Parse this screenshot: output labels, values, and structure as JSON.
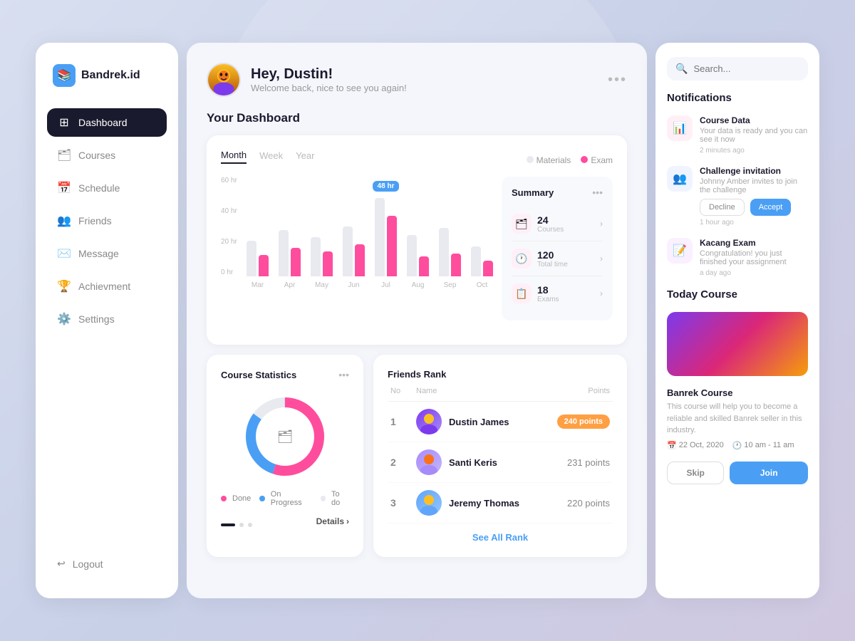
{
  "app": {
    "name": "Bandrek.id"
  },
  "sidebar": {
    "logo_label": "Bandrek.id",
    "nav_items": [
      {
        "id": "dashboard",
        "label": "Dashboard",
        "active": true
      },
      {
        "id": "courses",
        "label": "Courses",
        "active": false
      },
      {
        "id": "schedule",
        "label": "Schedule",
        "active": false
      },
      {
        "id": "friends",
        "label": "Friends",
        "active": false
      },
      {
        "id": "message",
        "label": "Message",
        "active": false
      },
      {
        "id": "achievment",
        "label": "Achievment",
        "active": false
      },
      {
        "id": "settings",
        "label": "Settings",
        "active": false
      }
    ],
    "logout_label": "Logout"
  },
  "header": {
    "greeting": "Hey, Dustin!",
    "subtext": "Welcome back, nice to see you again!"
  },
  "dashboard": {
    "title": "Your Dashboard"
  },
  "chart": {
    "tabs": [
      "Month",
      "Week",
      "Year"
    ],
    "active_tab": "Month",
    "legend": {
      "materials_label": "Materials",
      "exam_label": "Exam"
    },
    "y_labels": [
      "60 hr",
      "40 hr",
      "20 hr",
      "0 hr"
    ],
    "bars": [
      {
        "month": "Mar",
        "materials": 50,
        "exam": 30
      },
      {
        "month": "Apr",
        "materials": 60,
        "exam": 40
      },
      {
        "month": "May",
        "materials": 55,
        "exam": 35
      },
      {
        "month": "Jun",
        "materials": 65,
        "exam": 45
      },
      {
        "month": "Jul",
        "materials": 100,
        "exam": 80,
        "tooltip": "48 hr",
        "highlighted": true
      },
      {
        "month": "Aug",
        "materials": 55,
        "exam": 25
      },
      {
        "month": "Sep",
        "materials": 65,
        "exam": 30
      },
      {
        "month": "Oct",
        "materials": 40,
        "exam": 20
      }
    ],
    "summary": {
      "title": "Summary",
      "items": [
        {
          "label": "Courses",
          "value": "24"
        },
        {
          "label": "Total time",
          "value": "120"
        },
        {
          "label": "Exams",
          "value": "18"
        }
      ]
    }
  },
  "course_stats": {
    "title": "Course Statistics",
    "legend": [
      {
        "label": "Done",
        "color": "#ff4d9e"
      },
      {
        "label": "On Progress",
        "color": "#4a9ff5"
      },
      {
        "label": "To do",
        "color": "#e8eaf0"
      }
    ],
    "details_label": "Details",
    "donut": {
      "done_pct": 55,
      "progress_pct": 30,
      "todo_pct": 15
    }
  },
  "friends_rank": {
    "title": "Friends Rank",
    "headers": {
      "no": "No",
      "name": "Name",
      "points": "Points"
    },
    "rows": [
      {
        "rank": 1,
        "name": "Dustin James",
        "points": "240 points",
        "badge": true,
        "avatar_color": "#7c3aed"
      },
      {
        "rank": 2,
        "name": "Santi Keris",
        "points": "231 points",
        "badge": false,
        "avatar_color": "#a78bfa"
      },
      {
        "rank": 3,
        "name": "Jeremy Thomas",
        "points": "220 points",
        "badge": false,
        "avatar_color": "#60a5fa"
      }
    ],
    "see_all_label": "See All Rank"
  },
  "notifications": {
    "title": "Notifications",
    "items": [
      {
        "title": "Course Data",
        "body": "Your data is ready and you can see it now",
        "time": "2 minutes ago",
        "icon": "📊",
        "color": "pink",
        "has_actions": false
      },
      {
        "title": "Challenge invitation",
        "body": "Johnny Amber invites to join the challenge",
        "time": "1 hour ago",
        "icon": "👥",
        "color": "blue",
        "has_actions": true,
        "decline_label": "Decline",
        "accept_label": "Accept"
      },
      {
        "title": "Kacang Exam",
        "body": "Congratulation! you just finished your assignment",
        "time": "a day ago",
        "icon": "📝",
        "color": "purple",
        "has_actions": false
      }
    ]
  },
  "today_course": {
    "title": "Today Course",
    "course_title": "Banrek Course",
    "course_desc": "This course will help you to become a reliable and skilled Banrek seller in this industry.",
    "date": "22 Oct, 2020",
    "time": "10 am - 11 am",
    "skip_label": "Skip",
    "join_label": "Join"
  },
  "search": {
    "placeholder": "Search..."
  }
}
